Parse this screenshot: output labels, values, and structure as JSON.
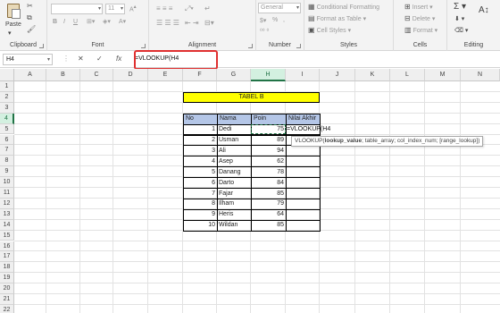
{
  "ribbon": {
    "clipboard": {
      "label": "Clipboard",
      "paste": "Paste"
    },
    "font": {
      "label": "Font",
      "font_name": "",
      "font_size": "11",
      "bold": "B",
      "italic": "I",
      "underline": "U"
    },
    "alignment": {
      "label": "Alignment"
    },
    "number": {
      "label": "Number",
      "format": "General",
      "currency": "$",
      "percent": "%",
      "comma": ","
    },
    "styles": {
      "label": "Styles",
      "conditional": "Conditional Formatting",
      "format_table": "Format as Table",
      "cell_styles": "Cell Styles"
    },
    "cells": {
      "label": "Cells",
      "insert": "Insert",
      "delete": "Delete",
      "format": "Format"
    },
    "editing": {
      "label": "Editing",
      "sum": "Σ"
    }
  },
  "formula_bar": {
    "name_box": "H4",
    "cancel": "✕",
    "enter": "✓",
    "fx": "fx",
    "formula": "=VLOOKUP(H4"
  },
  "columns": [
    "A",
    "B",
    "C",
    "D",
    "E",
    "F",
    "G",
    "H",
    "I",
    "J",
    "K",
    "L",
    "M",
    "N"
  ],
  "rows": [
    "1",
    "2",
    "3",
    "4",
    "5",
    "6",
    "7",
    "8",
    "9",
    "10",
    "11",
    "12",
    "13",
    "14",
    "15",
    "16",
    "17",
    "18",
    "19",
    "20",
    "21",
    "22"
  ],
  "table": {
    "title": "TABEL B",
    "headers": [
      "No",
      "Nama",
      "Poin",
      "Nilai Akhir"
    ],
    "data": [
      {
        "no": "1",
        "nama": "Dedi",
        "poin": "75",
        "nilai": "=VLOOKUP(H4"
      },
      {
        "no": "2",
        "nama": "Usman",
        "poin": "89",
        "nilai": ""
      },
      {
        "no": "3",
        "nama": "Ali",
        "poin": "94",
        "nilai": ""
      },
      {
        "no": "4",
        "nama": "Asep",
        "poin": "62",
        "nilai": ""
      },
      {
        "no": "5",
        "nama": "Danang",
        "poin": "78",
        "nilai": ""
      },
      {
        "no": "6",
        "nama": "Darto",
        "poin": "84",
        "nilai": ""
      },
      {
        "no": "7",
        "nama": "Fajar",
        "poin": "85",
        "nilai": ""
      },
      {
        "no": "8",
        "nama": "Ilham",
        "poin": "79",
        "nilai": ""
      },
      {
        "no": "9",
        "nama": "Heris",
        "poin": "64",
        "nilai": ""
      },
      {
        "no": "10",
        "nama": "Wildan",
        "poin": "85",
        "nilai": ""
      }
    ]
  },
  "tooltip": {
    "fn": "VLOOKUP(",
    "arg_active": "lookup_value",
    "rest": "; table_array; col_index_num; [range_lookup])"
  },
  "accent_color": "#217346",
  "highlight_color": "#e03030",
  "title_fill": "#ffff00",
  "header_fill": "#b4c6e7"
}
